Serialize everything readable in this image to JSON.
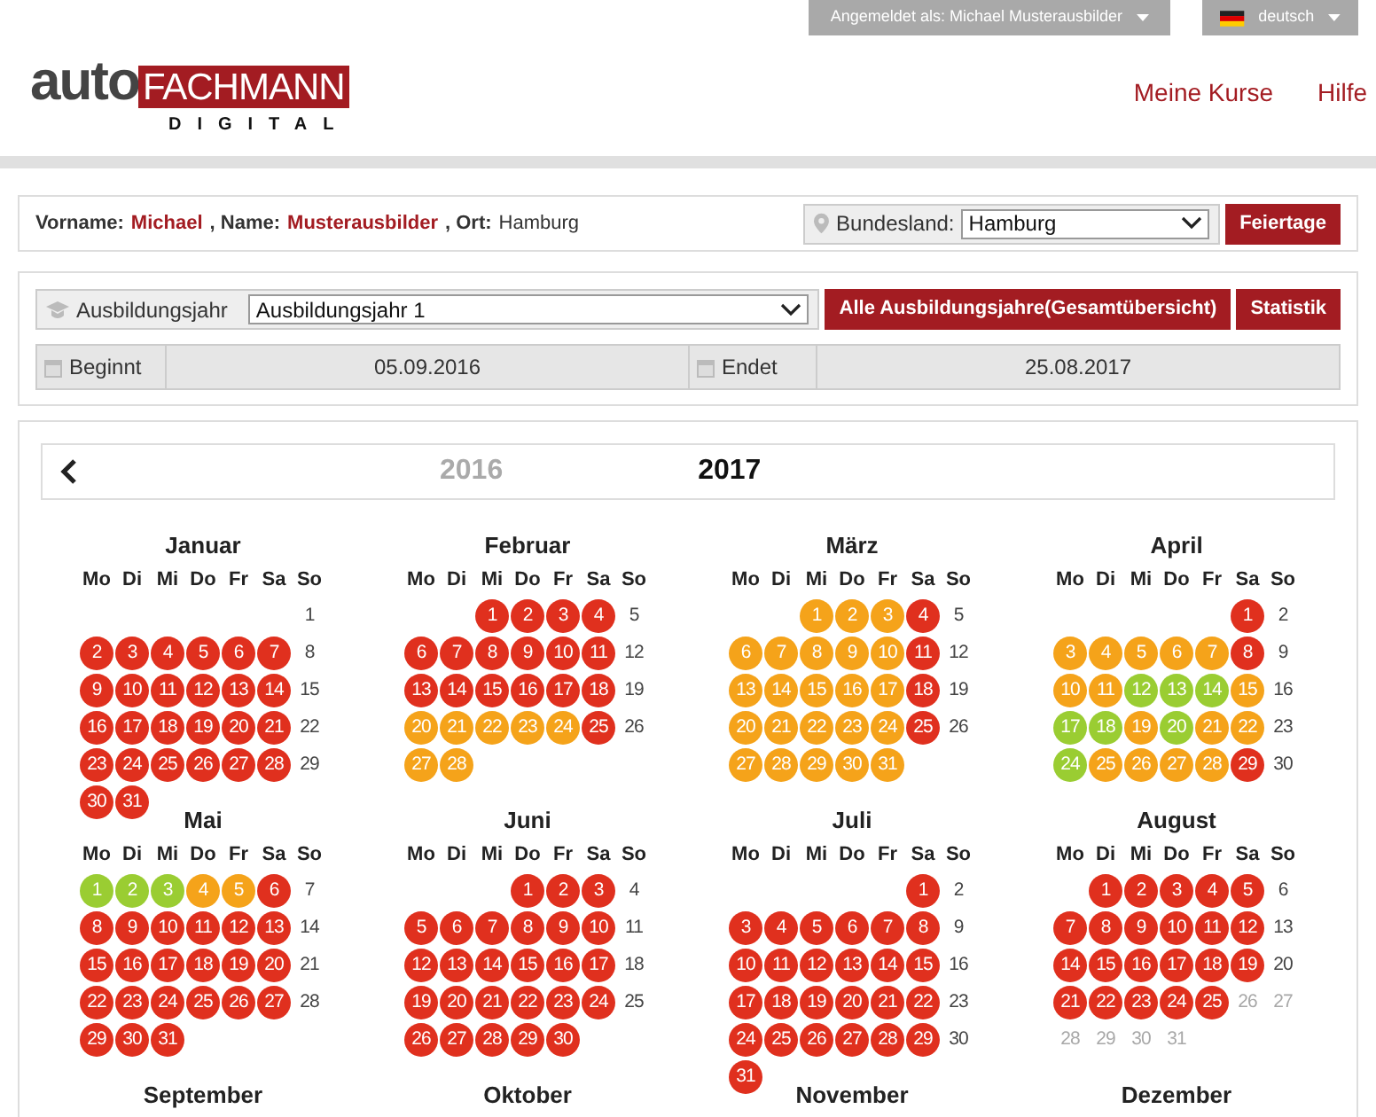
{
  "header": {
    "user_menu": "Angemeldet als: Michael Musterausbilder",
    "language_menu": "deutsch",
    "logo": {
      "word": "auto",
      "badge": "FACHMANN",
      "subtitle": "DIGITAL"
    },
    "nav": [
      "Meine Kurse",
      "Hilfe"
    ]
  },
  "profile": {
    "fields": [
      {
        "label": "Vorname:",
        "value": "Michael",
        "highlight": true
      },
      {
        "label": ", Name:",
        "value": "Musterausbilder",
        "highlight": true
      },
      {
        "label": ", Ort:",
        "value": "Hamburg",
        "highlight": false
      }
    ],
    "state_select": {
      "label": "Bundesland:",
      "value": "Hamburg"
    },
    "button": "Feiertage"
  },
  "training_year": {
    "label": "Ausbildungsjahr",
    "value": "Ausbildungsjahr 1",
    "buttons": [
      "Alle Ausbildungsjahre(Gesamtübersicht)",
      "Statistik"
    ],
    "dates": [
      {
        "label": "Beginnt",
        "value": "05.09.2016"
      },
      {
        "label": "Endet",
        "value": "25.08.2017"
      }
    ]
  },
  "calendar": {
    "years": [
      {
        "label": "2016",
        "selected": false
      },
      {
        "label": "2017",
        "selected": true
      }
    ],
    "months": [
      {
        "name": "Januar",
        "weekdays": [
          "Mo",
          "Di",
          "Mi",
          "Do",
          "Fr",
          "Sa",
          "So"
        ],
        "weeks": [
          [
            {
              "kind": "blank"
            },
            {
              "kind": "blank"
            },
            {
              "kind": "blank"
            },
            {
              "kind": "blank"
            },
            {
              "kind": "blank"
            },
            {
              "kind": "blank"
            },
            {
              "day": "1",
              "kind": "free"
            }
          ],
          [
            {
              "day": "2",
              "kind": "open"
            },
            {
              "day": "3",
              "kind": "open"
            },
            {
              "day": "4",
              "kind": "open"
            },
            {
              "day": "5",
              "kind": "open"
            },
            {
              "day": "6",
              "kind": "open"
            },
            {
              "day": "7",
              "kind": "open"
            },
            {
              "day": "8",
              "kind": "free"
            }
          ],
          [
            {
              "day": "9",
              "kind": "open"
            },
            {
              "day": "10",
              "kind": "open"
            },
            {
              "day": "11",
              "kind": "open"
            },
            {
              "day": "12",
              "kind": "open"
            },
            {
              "day": "13",
              "kind": "open"
            },
            {
              "day": "14",
              "kind": "open"
            },
            {
              "day": "15",
              "kind": "free"
            }
          ],
          [
            {
              "day": "16",
              "kind": "open"
            },
            {
              "day": "17",
              "kind": "open"
            },
            {
              "day": "18",
              "kind": "open"
            },
            {
              "day": "19",
              "kind": "open"
            },
            {
              "day": "20",
              "kind": "open"
            },
            {
              "day": "21",
              "kind": "open"
            },
            {
              "day": "22",
              "kind": "free"
            }
          ],
          [
            {
              "day": "23",
              "kind": "open"
            },
            {
              "day": "24",
              "kind": "open"
            },
            {
              "day": "25",
              "kind": "open"
            },
            {
              "day": "26",
              "kind": "open"
            },
            {
              "day": "27",
              "kind": "open"
            },
            {
              "day": "28",
              "kind": "open"
            },
            {
              "day": "29",
              "kind": "free"
            }
          ],
          [
            {
              "day": "30",
              "kind": "open"
            },
            {
              "day": "31",
              "kind": "open"
            }
          ]
        ]
      },
      {
        "name": "Februar",
        "weekdays": [
          "Mo",
          "Di",
          "Mi",
          "Do",
          "Fr",
          "Sa",
          "So"
        ],
        "weeks": [
          [
            {
              "kind": "blank"
            },
            {
              "kind": "blank"
            },
            {
              "day": "1",
              "kind": "open"
            },
            {
              "day": "2",
              "kind": "open"
            },
            {
              "day": "3",
              "kind": "open"
            },
            {
              "day": "4",
              "kind": "open"
            },
            {
              "day": "5",
              "kind": "free"
            }
          ],
          [
            {
              "day": "6",
              "kind": "open"
            },
            {
              "day": "7",
              "kind": "open"
            },
            {
              "day": "8",
              "kind": "open"
            },
            {
              "day": "9",
              "kind": "open"
            },
            {
              "day": "10",
              "kind": "open"
            },
            {
              "day": "11",
              "kind": "open"
            },
            {
              "day": "12",
              "kind": "free"
            }
          ],
          [
            {
              "day": "13",
              "kind": "open"
            },
            {
              "day": "14",
              "kind": "open"
            },
            {
              "day": "15",
              "kind": "open"
            },
            {
              "day": "16",
              "kind": "open"
            },
            {
              "day": "17",
              "kind": "open"
            },
            {
              "day": "18",
              "kind": "open"
            },
            {
              "day": "19",
              "kind": "free"
            }
          ],
          [
            {
              "day": "20",
              "kind": "partial"
            },
            {
              "day": "21",
              "kind": "partial"
            },
            {
              "day": "22",
              "kind": "partial"
            },
            {
              "day": "23",
              "kind": "partial"
            },
            {
              "day": "24",
              "kind": "partial"
            },
            {
              "day": "25",
              "kind": "open"
            },
            {
              "day": "26",
              "kind": "free"
            }
          ],
          [
            {
              "day": "27",
              "kind": "partial"
            },
            {
              "day": "28",
              "kind": "partial"
            }
          ]
        ]
      },
      {
        "name": "März",
        "weekdays": [
          "Mo",
          "Di",
          "Mi",
          "Do",
          "Fr",
          "Sa",
          "So"
        ],
        "weeks": [
          [
            {
              "kind": "blank"
            },
            {
              "kind": "blank"
            },
            {
              "day": "1",
              "kind": "partial"
            },
            {
              "day": "2",
              "kind": "partial"
            },
            {
              "day": "3",
              "kind": "partial"
            },
            {
              "day": "4",
              "kind": "open"
            },
            {
              "day": "5",
              "kind": "free"
            }
          ],
          [
            {
              "day": "6",
              "kind": "partial"
            },
            {
              "day": "7",
              "kind": "partial"
            },
            {
              "day": "8",
              "kind": "partial"
            },
            {
              "day": "9",
              "kind": "partial"
            },
            {
              "day": "10",
              "kind": "partial"
            },
            {
              "day": "11",
              "kind": "open"
            },
            {
              "day": "12",
              "kind": "free"
            }
          ],
          [
            {
              "day": "13",
              "kind": "partial"
            },
            {
              "day": "14",
              "kind": "partial"
            },
            {
              "day": "15",
              "kind": "partial"
            },
            {
              "day": "16",
              "kind": "partial"
            },
            {
              "day": "17",
              "kind": "partial"
            },
            {
              "day": "18",
              "kind": "open"
            },
            {
              "day": "19",
              "kind": "free"
            }
          ],
          [
            {
              "day": "20",
              "kind": "partial"
            },
            {
              "day": "21",
              "kind": "partial"
            },
            {
              "day": "22",
              "kind": "partial"
            },
            {
              "day": "23",
              "kind": "partial"
            },
            {
              "day": "24",
              "kind": "partial"
            },
            {
              "day": "25",
              "kind": "open"
            },
            {
              "day": "26",
              "kind": "free"
            }
          ],
          [
            {
              "day": "27",
              "kind": "partial"
            },
            {
              "day": "28",
              "kind": "partial"
            },
            {
              "day": "29",
              "kind": "partial"
            },
            {
              "day": "30",
              "kind": "partial"
            },
            {
              "day": "31",
              "kind": "partial"
            }
          ]
        ]
      },
      {
        "name": "April",
        "weekdays": [
          "Mo",
          "Di",
          "Mi",
          "Do",
          "Fr",
          "Sa",
          "So"
        ],
        "weeks": [
          [
            {
              "kind": "blank"
            },
            {
              "kind": "blank"
            },
            {
              "kind": "blank"
            },
            {
              "kind": "blank"
            },
            {
              "kind": "blank"
            },
            {
              "day": "1",
              "kind": "open"
            },
            {
              "day": "2",
              "kind": "free"
            }
          ],
          [
            {
              "day": "3",
              "kind": "partial"
            },
            {
              "day": "4",
              "kind": "partial"
            },
            {
              "day": "5",
              "kind": "partial"
            },
            {
              "day": "6",
              "kind": "partial"
            },
            {
              "day": "7",
              "kind": "partial"
            },
            {
              "day": "8",
              "kind": "open"
            },
            {
              "day": "9",
              "kind": "free"
            }
          ],
          [
            {
              "day": "10",
              "kind": "partial"
            },
            {
              "day": "11",
              "kind": "partial"
            },
            {
              "day": "12",
              "kind": "done"
            },
            {
              "day": "13",
              "kind": "done"
            },
            {
              "day": "14",
              "kind": "done"
            },
            {
              "day": "15",
              "kind": "partial"
            },
            {
              "day": "16",
              "kind": "free"
            }
          ],
          [
            {
              "day": "17",
              "kind": "done"
            },
            {
              "day": "18",
              "kind": "done"
            },
            {
              "day": "19",
              "kind": "partial"
            },
            {
              "day": "20",
              "kind": "done"
            },
            {
              "day": "21",
              "kind": "partial"
            },
            {
              "day": "22",
              "kind": "partial"
            },
            {
              "day": "23",
              "kind": "free"
            }
          ],
          [
            {
              "day": "24",
              "kind": "done"
            },
            {
              "day": "25",
              "kind": "partial"
            },
            {
              "day": "26",
              "kind": "partial"
            },
            {
              "day": "27",
              "kind": "partial"
            },
            {
              "day": "28",
              "kind": "partial"
            },
            {
              "day": "29",
              "kind": "open"
            },
            {
              "day": "30",
              "kind": "free"
            }
          ]
        ]
      },
      {
        "name": "Mai",
        "weekdays": [
          "Mo",
          "Di",
          "Mi",
          "Do",
          "Fr",
          "Sa",
          "So"
        ],
        "weeks": [
          [
            {
              "day": "1",
              "kind": "done"
            },
            {
              "day": "2",
              "kind": "done"
            },
            {
              "day": "3",
              "kind": "done"
            },
            {
              "day": "4",
              "kind": "partial"
            },
            {
              "day": "5",
              "kind": "partial"
            },
            {
              "day": "6",
              "kind": "open"
            },
            {
              "day": "7",
              "kind": "free"
            }
          ],
          [
            {
              "day": "8",
              "kind": "open"
            },
            {
              "day": "9",
              "kind": "open"
            },
            {
              "day": "10",
              "kind": "open"
            },
            {
              "day": "11",
              "kind": "open"
            },
            {
              "day": "12",
              "kind": "open"
            },
            {
              "day": "13",
              "kind": "open"
            },
            {
              "day": "14",
              "kind": "free"
            }
          ],
          [
            {
              "day": "15",
              "kind": "open"
            },
            {
              "day": "16",
              "kind": "open"
            },
            {
              "day": "17",
              "kind": "open"
            },
            {
              "day": "18",
              "kind": "open"
            },
            {
              "day": "19",
              "kind": "open"
            },
            {
              "day": "20",
              "kind": "open"
            },
            {
              "day": "21",
              "kind": "free"
            }
          ],
          [
            {
              "day": "22",
              "kind": "open"
            },
            {
              "day": "23",
              "kind": "open"
            },
            {
              "day": "24",
              "kind": "open"
            },
            {
              "day": "25",
              "kind": "open"
            },
            {
              "day": "26",
              "kind": "open"
            },
            {
              "day": "27",
              "kind": "open"
            },
            {
              "day": "28",
              "kind": "free"
            }
          ],
          [
            {
              "day": "29",
              "kind": "open"
            },
            {
              "day": "30",
              "kind": "open"
            },
            {
              "day": "31",
              "kind": "open"
            }
          ]
        ]
      },
      {
        "name": "Juni",
        "weekdays": [
          "Mo",
          "Di",
          "Mi",
          "Do",
          "Fr",
          "Sa",
          "So"
        ],
        "weeks": [
          [
            {
              "kind": "blank"
            },
            {
              "kind": "blank"
            },
            {
              "kind": "blank"
            },
            {
              "day": "1",
              "kind": "open"
            },
            {
              "day": "2",
              "kind": "open"
            },
            {
              "day": "3",
              "kind": "open"
            },
            {
              "day": "4",
              "kind": "free"
            }
          ],
          [
            {
              "day": "5",
              "kind": "open"
            },
            {
              "day": "6",
              "kind": "open"
            },
            {
              "day": "7",
              "kind": "open"
            },
            {
              "day": "8",
              "kind": "open"
            },
            {
              "day": "9",
              "kind": "open"
            },
            {
              "day": "10",
              "kind": "open"
            },
            {
              "day": "11",
              "kind": "free"
            }
          ],
          [
            {
              "day": "12",
              "kind": "open"
            },
            {
              "day": "13",
              "kind": "open"
            },
            {
              "day": "14",
              "kind": "open"
            },
            {
              "day": "15",
              "kind": "open"
            },
            {
              "day": "16",
              "kind": "open"
            },
            {
              "day": "17",
              "kind": "open"
            },
            {
              "day": "18",
              "kind": "free"
            }
          ],
          [
            {
              "day": "19",
              "kind": "open"
            },
            {
              "day": "20",
              "kind": "open"
            },
            {
              "day": "21",
              "kind": "open"
            },
            {
              "day": "22",
              "kind": "open"
            },
            {
              "day": "23",
              "kind": "open"
            },
            {
              "day": "24",
              "kind": "open"
            },
            {
              "day": "25",
              "kind": "free"
            }
          ],
          [
            {
              "day": "26",
              "kind": "open"
            },
            {
              "day": "27",
              "kind": "open"
            },
            {
              "day": "28",
              "kind": "open"
            },
            {
              "day": "29",
              "kind": "open"
            },
            {
              "day": "30",
              "kind": "open"
            }
          ]
        ]
      },
      {
        "name": "Juli",
        "weekdays": [
          "Mo",
          "Di",
          "Mi",
          "Do",
          "Fr",
          "Sa",
          "So"
        ],
        "weeks": [
          [
            {
              "kind": "blank"
            },
            {
              "kind": "blank"
            },
            {
              "kind": "blank"
            },
            {
              "kind": "blank"
            },
            {
              "kind": "blank"
            },
            {
              "day": "1",
              "kind": "open"
            },
            {
              "day": "2",
              "kind": "free"
            }
          ],
          [
            {
              "day": "3",
              "kind": "open"
            },
            {
              "day": "4",
              "kind": "open"
            },
            {
              "day": "5",
              "kind": "open"
            },
            {
              "day": "6",
              "kind": "open"
            },
            {
              "day": "7",
              "kind": "open"
            },
            {
              "day": "8",
              "kind": "open"
            },
            {
              "day": "9",
              "kind": "free"
            }
          ],
          [
            {
              "day": "10",
              "kind": "open"
            },
            {
              "day": "11",
              "kind": "open"
            },
            {
              "day": "12",
              "kind": "open"
            },
            {
              "day": "13",
              "kind": "open"
            },
            {
              "day": "14",
              "kind": "open"
            },
            {
              "day": "15",
              "kind": "open"
            },
            {
              "day": "16",
              "kind": "free"
            }
          ],
          [
            {
              "day": "17",
              "kind": "open"
            },
            {
              "day": "18",
              "kind": "open"
            },
            {
              "day": "19",
              "kind": "open"
            },
            {
              "day": "20",
              "kind": "open"
            },
            {
              "day": "21",
              "kind": "open"
            },
            {
              "day": "22",
              "kind": "open"
            },
            {
              "day": "23",
              "kind": "free"
            }
          ],
          [
            {
              "day": "24",
              "kind": "open"
            },
            {
              "day": "25",
              "kind": "open"
            },
            {
              "day": "26",
              "kind": "open"
            },
            {
              "day": "27",
              "kind": "open"
            },
            {
              "day": "28",
              "kind": "open"
            },
            {
              "day": "29",
              "kind": "open"
            },
            {
              "day": "30",
              "kind": "free"
            }
          ],
          [
            {
              "day": "31",
              "kind": "open"
            }
          ]
        ]
      },
      {
        "name": "August",
        "weekdays": [
          "Mo",
          "Di",
          "Mi",
          "Do",
          "Fr",
          "Sa",
          "So"
        ],
        "weeks": [
          [
            {
              "kind": "blank"
            },
            {
              "day": "1",
              "kind": "open"
            },
            {
              "day": "2",
              "kind": "open"
            },
            {
              "day": "3",
              "kind": "open"
            },
            {
              "day": "4",
              "kind": "open"
            },
            {
              "day": "5",
              "kind": "open"
            },
            {
              "day": "6",
              "kind": "free"
            }
          ],
          [
            {
              "day": "7",
              "kind": "open"
            },
            {
              "day": "8",
              "kind": "open"
            },
            {
              "day": "9",
              "kind": "open"
            },
            {
              "day": "10",
              "kind": "open"
            },
            {
              "day": "11",
              "kind": "open"
            },
            {
              "day": "12",
              "kind": "open"
            },
            {
              "day": "13",
              "kind": "free"
            }
          ],
          [
            {
              "day": "14",
              "kind": "open"
            },
            {
              "day": "15",
              "kind": "open"
            },
            {
              "day": "16",
              "kind": "open"
            },
            {
              "day": "17",
              "kind": "open"
            },
            {
              "day": "18",
              "kind": "open"
            },
            {
              "day": "19",
              "kind": "open"
            },
            {
              "day": "20",
              "kind": "free"
            }
          ],
          [
            {
              "day": "21",
              "kind": "open"
            },
            {
              "day": "22",
              "kind": "open"
            },
            {
              "day": "23",
              "kind": "open"
            },
            {
              "day": "24",
              "kind": "open"
            },
            {
              "day": "25",
              "kind": "open"
            },
            {
              "day": "26",
              "kind": "inactive"
            },
            {
              "day": "27",
              "kind": "inactive"
            }
          ],
          [
            {
              "day": "28",
              "kind": "inactive"
            },
            {
              "day": "29",
              "kind": "inactive"
            },
            {
              "day": "30",
              "kind": "inactive"
            },
            {
              "day": "31",
              "kind": "inactive"
            }
          ]
        ]
      },
      {
        "name": "September"
      },
      {
        "name": "Oktober"
      },
      {
        "name": "November"
      },
      {
        "name": "Dezember"
      }
    ]
  }
}
